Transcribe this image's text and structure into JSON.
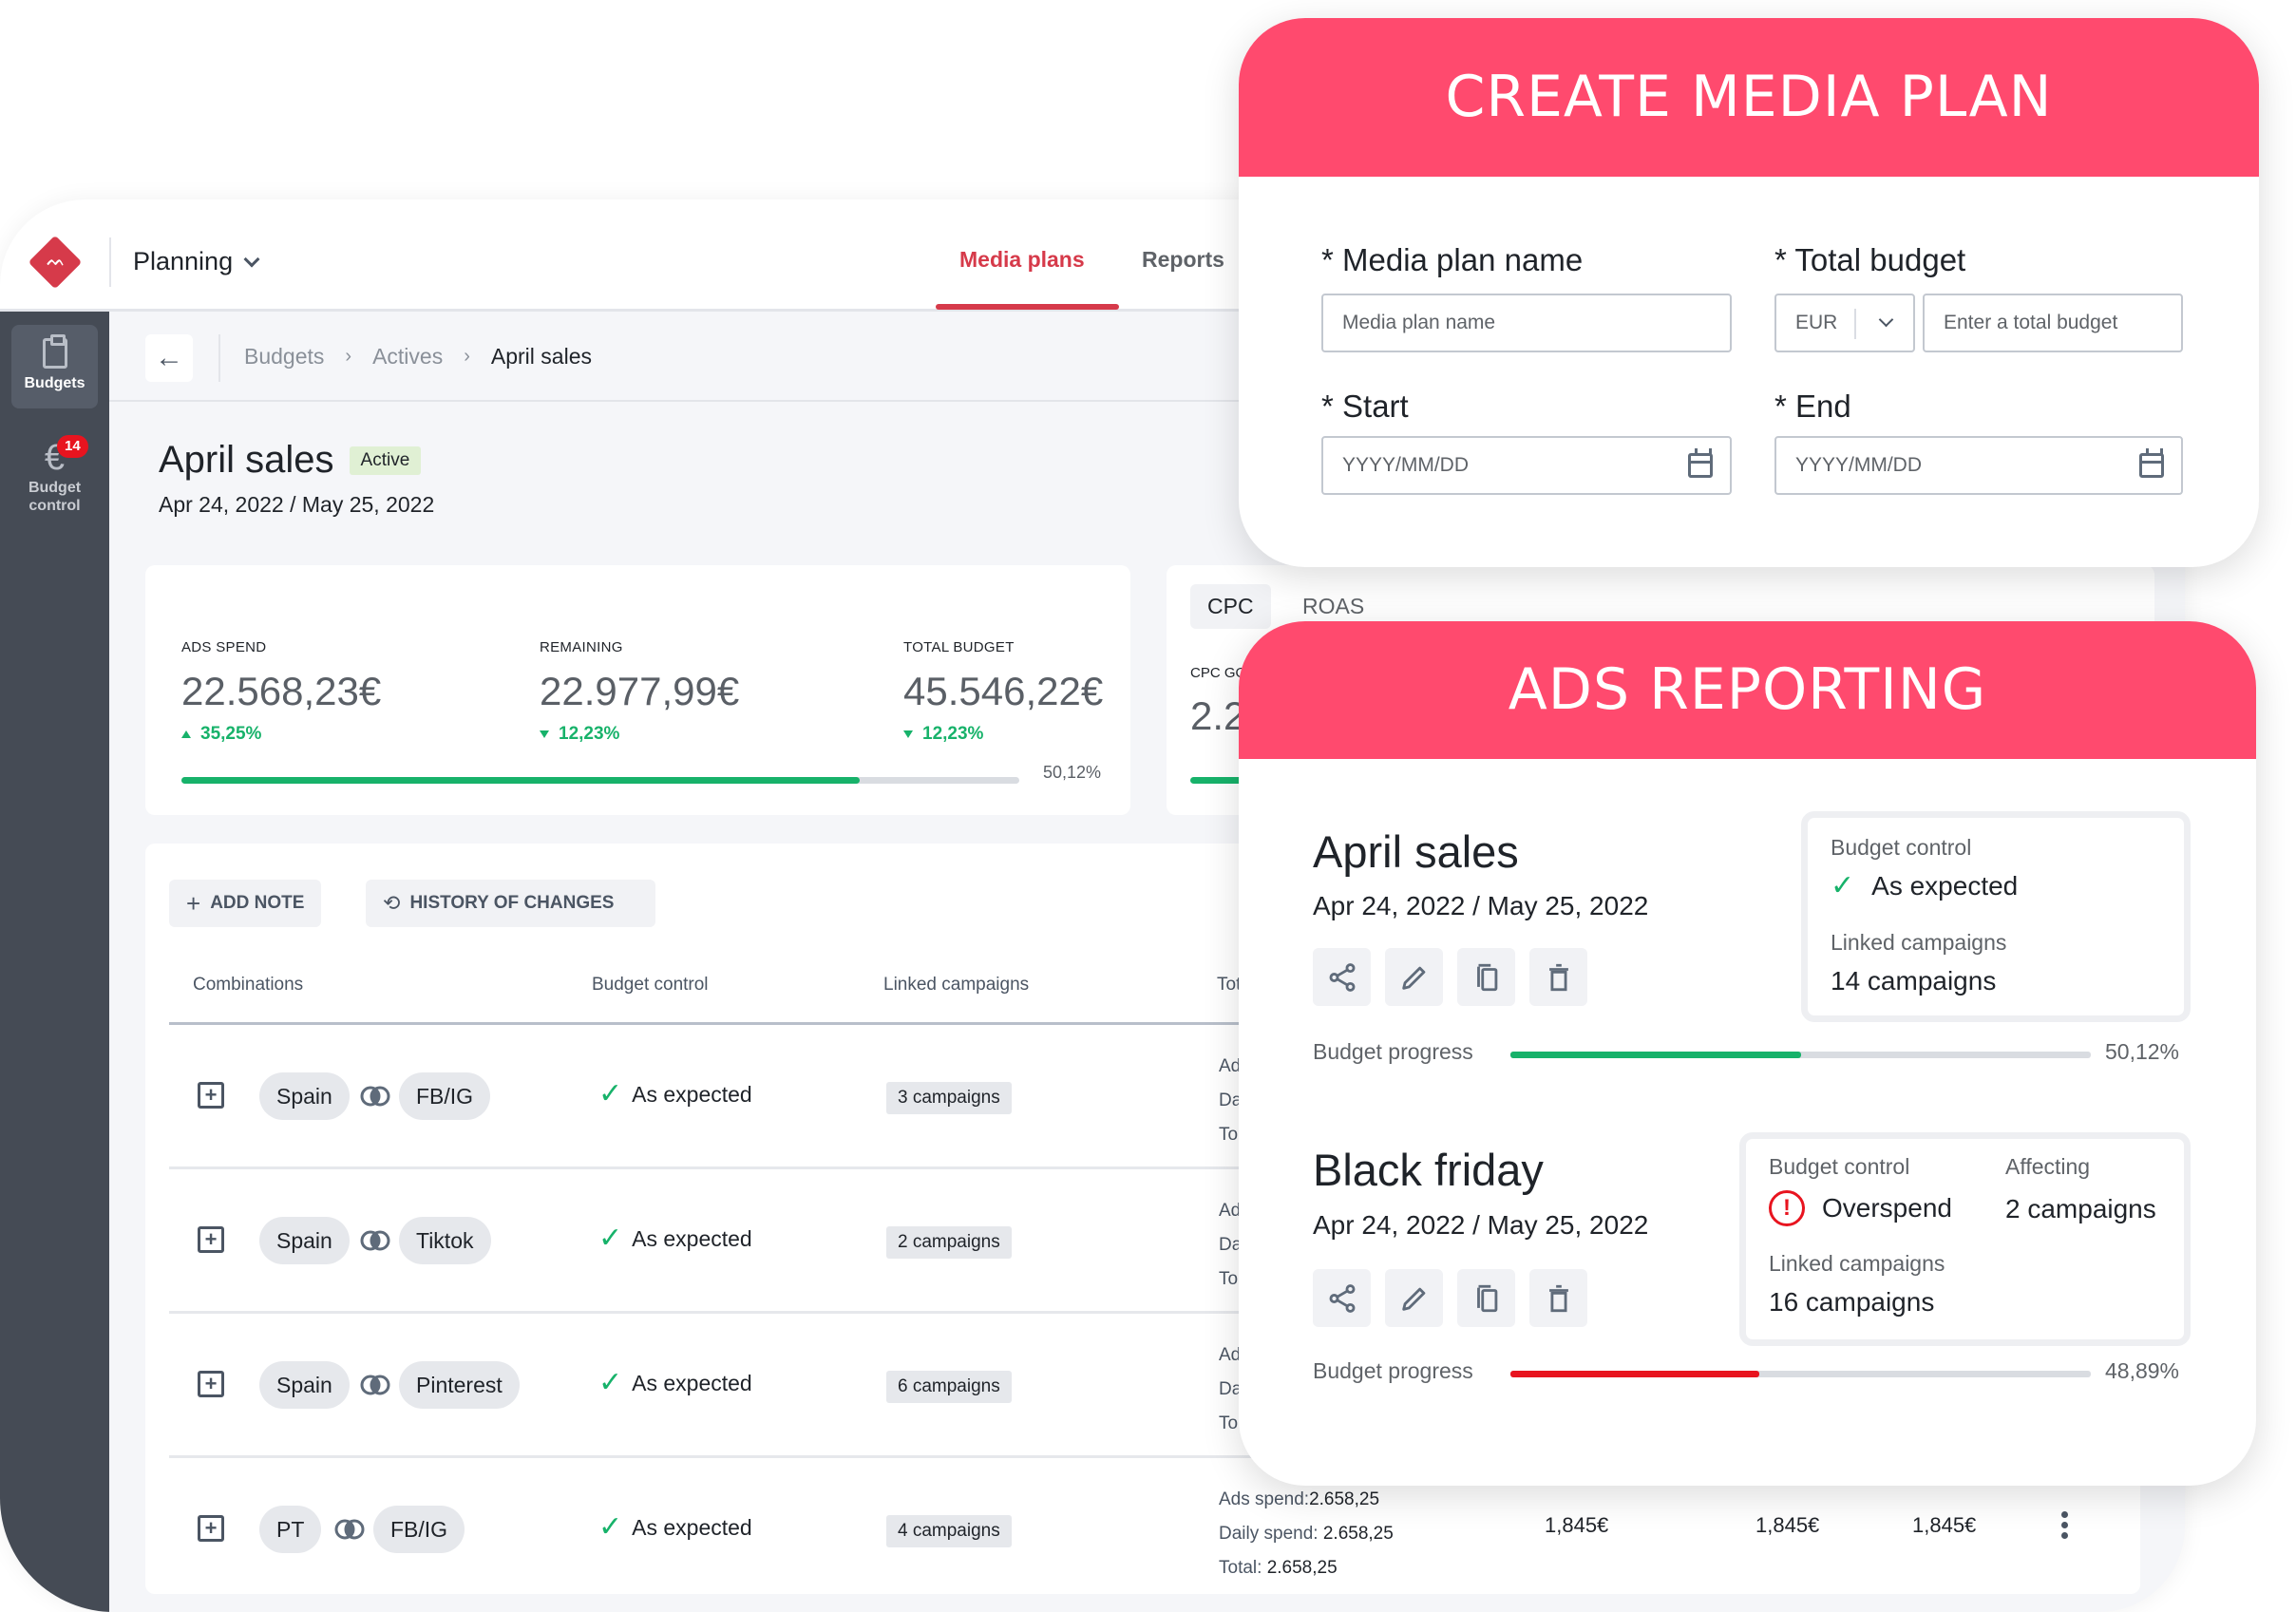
{
  "app": {
    "section_switcher": "Planning",
    "nav_tabs": [
      {
        "label": "Media plans",
        "active": true
      },
      {
        "label": "Reports",
        "active": false
      }
    ],
    "accent_color": "#d63a4a"
  },
  "sidebar": {
    "items": [
      {
        "label": "Budgets",
        "icon": "clipboard-icon",
        "active": true
      },
      {
        "label_line1": "Budget",
        "label_line2": "control",
        "icon": "euro-icon",
        "badge": "14"
      }
    ]
  },
  "breadcrumb": {
    "items": [
      "Budgets",
      "Actives",
      "April sales"
    ]
  },
  "page": {
    "title": "April sales",
    "status": "Active",
    "dates": "Apr 24, 2022 / May 25, 2022"
  },
  "kpis": {
    "items": [
      {
        "label": "ADS SPEND",
        "value": "22.568,23€",
        "delta": "35,25%",
        "direction": "up"
      },
      {
        "label": "REMAINING",
        "value": "22.977,99€",
        "delta": "12,23%",
        "direction": "down"
      },
      {
        "label": "TOTAL BUDGET",
        "value": "45.546,22€",
        "delta": "12,23%",
        "direction": "down"
      }
    ],
    "progress_label": "50,12%",
    "progress_fraction": 0.81
  },
  "cpc_card": {
    "tabs": [
      "CPC",
      "ROAS"
    ],
    "goal_label": "CPC GO",
    "value": "2.2"
  },
  "table": {
    "buttons": {
      "add_note": "ADD NOTE",
      "history": "HISTORY OF CHANGES"
    },
    "headers": [
      "Combinations",
      "Budget control",
      "Linked campaigns",
      "Tot"
    ],
    "rows": [
      {
        "country": "Spain",
        "channel": "FB/IG",
        "budget_control": "As expected",
        "campaigns": "3 campaigns",
        "spend_partial": [
          "Ad",
          "Da",
          "To"
        ]
      },
      {
        "country": "Spain",
        "channel": "Tiktok",
        "budget_control": "As expected",
        "campaigns": "2 campaigns",
        "spend_partial": [
          "Ad",
          "Da",
          "To"
        ]
      },
      {
        "country": "Spain",
        "channel": "Pinterest",
        "budget_control": "As expected",
        "campaigns": "6 campaigns",
        "spend_partial": [
          "Ad",
          "Da",
          "To"
        ]
      },
      {
        "country": "PT",
        "channel": "FB/IG",
        "budget_control": "As expected",
        "campaigns": "4 campaigns",
        "ads_spend_label": "Ads spend:",
        "ads_spend": "2.658,25",
        "daily_spend_label": "Daily spend:",
        "daily_spend": "2.658,25",
        "total_label": "Total:",
        "total": "2.658,25",
        "col_a": "1,845€",
        "col_b": "1,845€",
        "col_c": "1,845€"
      }
    ]
  },
  "create_media_plan": {
    "title": "CREATE MEDIA PLAN",
    "name_label": "* Media plan name",
    "name_placeholder": "Media plan name",
    "budget_label": "* Total budget",
    "currency": "EUR",
    "budget_placeholder": "Enter a total budget",
    "start_label": "* Start",
    "start_placeholder": "YYYY/MM/DD",
    "end_label": "* End",
    "end_placeholder": "YYYY/MM/DD",
    "header_color": "#ff4a6e"
  },
  "ads_reporting": {
    "title": "ADS REPORTING",
    "plans": [
      {
        "name": "April sales",
        "dates": "Apr 24, 2022 / May 25, 2022",
        "budget_control_label": "Budget control",
        "budget_control": "As expected",
        "linked_label": "Linked campaigns",
        "linked": "14 campaigns",
        "progress_label": "Budget progress",
        "progress_text": "50,12%",
        "progress_fraction": 0.5012,
        "progress_color": "#17b26a"
      },
      {
        "name": "Black friday",
        "dates": "Apr 24, 2022 / May 25, 2022",
        "budget_control_label": "Budget control",
        "budget_control": "Overspend",
        "affecting_label": "Affecting",
        "affecting": "2 campaigns",
        "linked_label": "Linked campaigns",
        "linked": "16 campaigns",
        "progress_label": "Budget progress",
        "progress_text": "48,89%",
        "progress_fraction": 0.4289,
        "progress_color": "#e8141f"
      }
    ]
  }
}
